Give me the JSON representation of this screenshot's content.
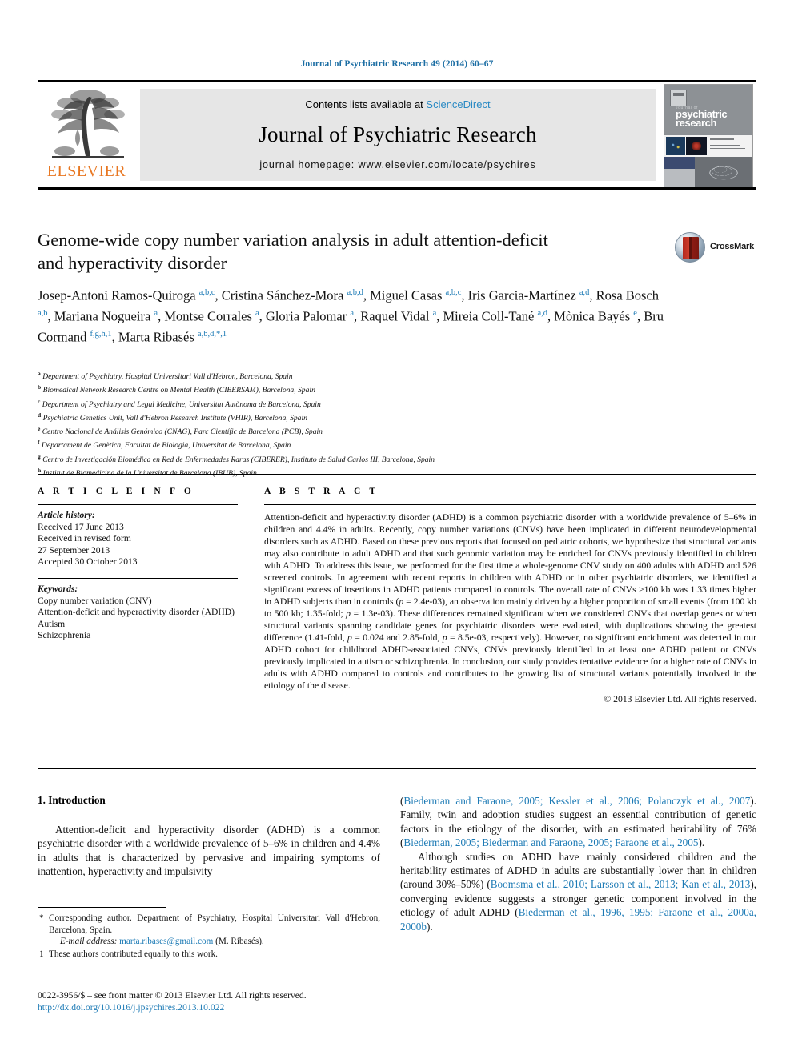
{
  "running_head": "Journal of Psychiatric Research 49 (2014) 60–67",
  "masthead": {
    "contents_prefix": "Contents lists available at ",
    "sciencedirect": "ScienceDirect",
    "journal_title": "Journal of Psychiatric Research",
    "homepage": "journal homepage: www.elsevier.com/locate/psychires",
    "publisher_wordmark": "ELSEVIER",
    "cover_journal_line1": "Journal of",
    "cover_journal_line2": "psychiatric",
    "cover_journal_line3": "research",
    "accent_link_color": "#2a8ac4",
    "band_color": "#e6e6e6",
    "elsevier_orange": "#e87722"
  },
  "crossmark": {
    "label": "CrossMark"
  },
  "article": {
    "title": "Genome-wide copy number variation analysis in adult attention-deficit and hyperactivity disorder",
    "authors_html": "Josep-Antoni Ramos-Quiroga <sup>a,b,c</sup>, Cristina Sánchez-Mora <sup>a,b,d</sup>, Miguel Casas <sup>a,b,c</sup>, Iris Garcia-Martínez <sup>a,d</sup>, Rosa Bosch <sup>a,b</sup>, Mariana Nogueira <sup>a</sup>, Montse Corrales <sup>a</sup>, Gloria Palomar <sup>a</sup>, Raquel Vidal <sup>a</sup>, Mireia Coll-Tané <sup>a,d</sup>, Mònica Bayés <sup>e</sup>, Bru Cormand <sup>f,g,h,1</sup>, Marta Ribasés <sup>a,b,d,</sup><sup>*,1</sup>",
    "affiliations": [
      {
        "mark": "a",
        "text": "Department of Psychiatry, Hospital Universitari Vall d'Hebron, Barcelona, Spain"
      },
      {
        "mark": "b",
        "text": "Biomedical Network Research Centre on Mental Health (CIBERSAM), Barcelona, Spain"
      },
      {
        "mark": "c",
        "text": "Department of Psychiatry and Legal Medicine, Universitat Autònoma de Barcelona, Spain"
      },
      {
        "mark": "d",
        "text": "Psychiatric Genetics Unit, Vall d'Hebron Research Institute (VHIR), Barcelona, Spain"
      },
      {
        "mark": "e",
        "text": "Centro Nacional de Análisis Genómico (CNAG), Parc Científic de Barcelona (PCB), Spain"
      },
      {
        "mark": "f",
        "text": "Departament de Genètica, Facultat de Biologia, Universitat de Barcelona, Spain"
      },
      {
        "mark": "g",
        "text": "Centro de Investigación Biomédica en Red de Enfermedades Raras (CIBERER), Instituto de Salud Carlos III, Barcelona, Spain"
      },
      {
        "mark": "h",
        "text": "Institut de Biomedicina de la Universitat de Barcelona (IBUB), Spain"
      }
    ]
  },
  "article_info": {
    "heading": "A R T I C L E  I N F O",
    "history_label": "Article history:",
    "history_lines": [
      "Received 17 June 2013",
      "Received in revised form",
      "27 September 2013",
      "Accepted 30 October 2013"
    ],
    "keywords_label": "Keywords:",
    "keywords": [
      "Copy number variation (CNV)",
      "Attention-deficit and hyperactivity disorder (ADHD)",
      "Autism",
      "Schizophrenia"
    ]
  },
  "abstract": {
    "heading": "A B S T R A C T",
    "body_html": "Attention-deficit and hyperactivity disorder (ADHD) is a common psychiatric disorder with a worldwide prevalence of 5&ndash;6% in children and 4.4% in adults. Recently, copy number variations (CNVs) have been implicated in different neurodevelopmental disorders such as ADHD. Based on these previous reports that focused on pediatric cohorts, we hypothesize that structural variants may also contribute to adult ADHD and that such genomic variation may be enriched for CNVs previously identified in children with ADHD. To address this issue, we performed for the first time a whole-genome CNV study on 400 adults with ADHD and 526 screened controls. In agreement with recent reports in children with ADHD or in other psychiatric disorders, we identified a significant excess of insertions in ADHD patients compared to controls. The overall rate of CNVs &gt;100 kb was 1.33 times higher in ADHD subjects than in controls (<i>p</i> = 2.4e-03), an observation mainly driven by a higher proportion of small events (from 100 kb to 500 kb; 1.35-fold; <i>p</i> = 1.3e-03). These differences remained significant when we considered CNVs that overlap genes or when structural variants spanning candidate genes for psychiatric disorders were evaluated, with duplications showing the greatest difference (1.41-fold, <i>p</i> = 0.024 and 2.85-fold, <i>p</i> = 8.5e-03, respectively). However, no significant enrichment was detected in our ADHD cohort for childhood ADHD-associated CNVs, CNVs previously identified in at least one ADHD patient or CNVs previously implicated in autism or schizophrenia. In conclusion, our study provides tentative evidence for a higher rate of CNVs in adults with ADHD compared to controls and contributes to the growing list of structural variants potentially involved in the etiology of the disease.",
    "copyright": "© 2013 Elsevier Ltd. All rights reserved."
  },
  "introduction": {
    "heading": "1.  Introduction",
    "left_paragraph_html": "Attention-deficit and hyperactivity disorder (ADHD) is a common psychiatric disorder with a worldwide prevalence of 5&ndash;6% in children and 4.4% in adults that is characterized by pervasive and impairing symptoms of inattention, hyperactivity and impulsivity",
    "right_paragraph_1_html": "(<span class=\"ref\">Biederman and Faraone, 2005; Kessler et al., 2006; Polanczyk et al., 2007</span>). Family, twin and adoption studies suggest an essential contribution of genetic factors in the etiology of the disorder, with an estimated heritability of 76% (<span class=\"ref\">Biederman, 2005; Biederman and Faraone, 2005; Faraone et al., 2005</span>).",
    "right_paragraph_2_html": "Although studies on ADHD have mainly considered children and the heritability estimates of ADHD in adults are substantially lower than in children (around 30%&ndash;50%) (<span class=\"ref\">Boomsma et al., 2010; Larsson et al., 2013; Kan et al., 2013</span>), converging evidence suggests a stronger genetic component involved in the etiology of adult ADHD (<span class=\"ref\">Biederman et al., 1996, 1995; Faraone et al., 2000a, 2000b</span>)."
  },
  "footnotes": {
    "corresponding_mark": "*",
    "corresponding_text": "Corresponding author. Department of Psychiatry, Hospital Universitari Vall d'Hebron, Barcelona, Spain.",
    "email_label": "E-mail address:",
    "email": "marta.ribases@gmail.com",
    "email_suffix": "(M. Ribasés).",
    "equal_mark": "1",
    "equal_text": "These authors contributed equally to this work."
  },
  "imprint": {
    "line1": "0022-3956/$ – see front matter © 2013 Elsevier Ltd. All rights reserved.",
    "doi": "http://dx.doi.org/10.1016/j.jpsychires.2013.10.022"
  }
}
